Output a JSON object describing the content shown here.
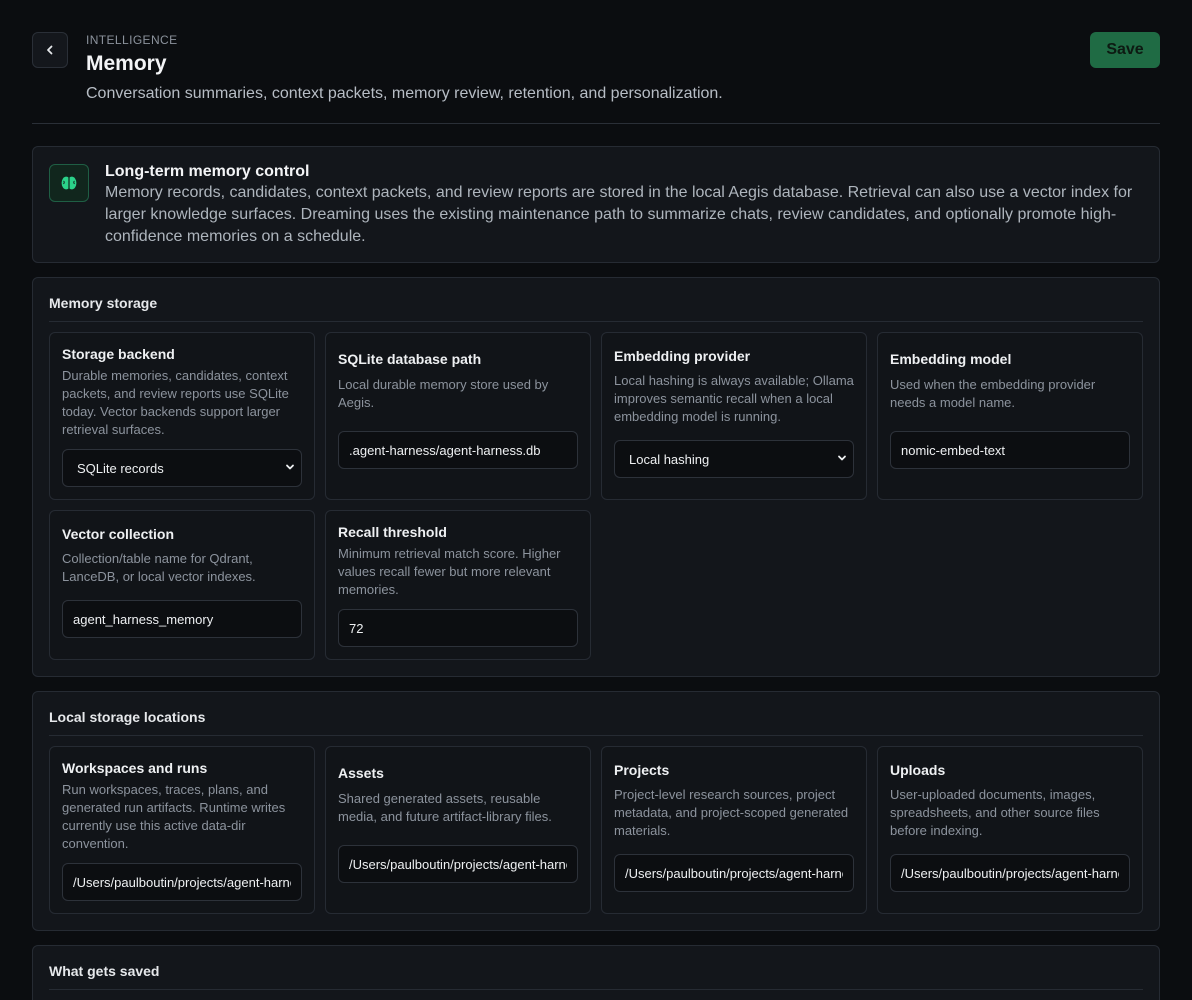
{
  "header": {
    "eyebrow": "INTELLIGENCE",
    "title": "Memory",
    "description": "Conversation summaries, context packets, memory review, retention, and personalization.",
    "save_label": "Save"
  },
  "intro": {
    "title": "Long-term memory control",
    "text": "Memory records, candidates, context packets, and review reports are stored in the local Aegis database. Retrieval can also use a vector index for larger knowledge surfaces. Dreaming uses the existing maintenance path to summarize chats, review candidates, and optionally promote high-confidence memories on a schedule.",
    "icon": "brain-icon",
    "accent": "#2bd38a"
  },
  "memory_storage": {
    "title": "Memory storage",
    "storage_backend": {
      "label": "Storage backend",
      "description": "Durable memories, candidates, context packets, and review reports use SQLite today. Vector backends support larger retrieval surfaces.",
      "selected": "SQLite records"
    },
    "sqlite_path": {
      "label": "SQLite database path",
      "description": "Local durable memory store used by Aegis.",
      "value": ".agent-harness/agent-harness.db"
    },
    "embedding_provider": {
      "label": "Embedding provider",
      "description": "Local hashing is always available; Ollama improves semantic recall when a local embedding model is running.",
      "selected": "Local hashing"
    },
    "embedding_model": {
      "label": "Embedding model",
      "description": "Used when the embedding provider needs a model name.",
      "value": "nomic-embed-text"
    },
    "vector_collection": {
      "label": "Vector collection",
      "description": "Collection/table name for Qdrant, LanceDB, or local vector indexes.",
      "value": "agent_harness_memory"
    },
    "recall_threshold": {
      "label": "Recall threshold",
      "description": "Minimum retrieval match score. Higher values recall fewer but more relevant memories.",
      "value": "72"
    }
  },
  "local_storage": {
    "title": "Local storage locations",
    "workspaces": {
      "label": "Workspaces and runs",
      "description": "Run workspaces, traces, plans, and generated run artifacts. Runtime writes currently use this active data-dir convention.",
      "value": "/Users/paulboutin/projects/agent-harness"
    },
    "assets": {
      "label": "Assets",
      "description": "Shared generated assets, reusable media, and future artifact-library files.",
      "value": "/Users/paulboutin/projects/agent-harness"
    },
    "projects": {
      "label": "Projects",
      "description": "Project-level research sources, project metadata, and project-scoped generated materials.",
      "value": "/Users/paulboutin/projects/agent-harness"
    },
    "uploads": {
      "label": "Uploads",
      "description": "User-uploaded documents, images, spreadsheets, and other source files before indexing.",
      "value": "/Users/paulboutin/projects/agent-harness"
    }
  },
  "what_gets_saved": {
    "title": "What gets saved"
  }
}
